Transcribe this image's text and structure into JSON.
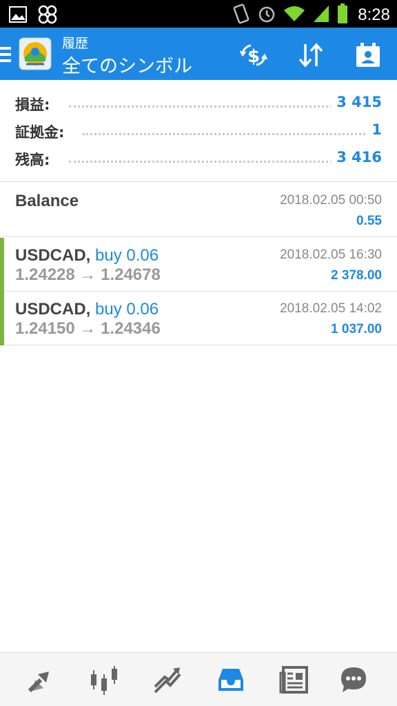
{
  "status_bar": {
    "time": "8:28",
    "icons": [
      "image-icon",
      "fan-icon",
      "vibrate-icon",
      "alarm-icon",
      "wifi-icon",
      "signal-icon",
      "battery-icon"
    ]
  },
  "appbar": {
    "subtitle": "履歴",
    "title": "全てのシンボル",
    "icons": [
      "menu-icon",
      "app-logo",
      "currency-exchange-icon",
      "sort-icon",
      "calendar-icon"
    ],
    "color": "#1e88e5"
  },
  "summary": [
    {
      "label": "損益:",
      "value": "3 415"
    },
    {
      "label": "証拠金:",
      "value": "1"
    },
    {
      "label": "残高:",
      "value": "3 416"
    }
  ],
  "history": {
    "balance": {
      "title": "Balance",
      "date": "2018.02.05 00:50",
      "amount": "0.55"
    },
    "trades": [
      {
        "symbol": "USDCAD,",
        "type": "buy 0.06",
        "prices": "1.24228 → 1.24678",
        "date": "2018.02.05 16:30",
        "profit": "2 378.00"
      },
      {
        "symbol": "USDCAD,",
        "type": "buy 0.06",
        "prices": "1.24150 → 1.24346",
        "date": "2018.02.05 14:02",
        "profit": "1 037.00"
      }
    ]
  },
  "bottom_nav": {
    "items": [
      "quotes-icon",
      "chart-icon",
      "trade-icon",
      "history-icon",
      "news-icon",
      "chat-icon"
    ],
    "active": "history-icon",
    "active_color": "#1e88e5"
  }
}
